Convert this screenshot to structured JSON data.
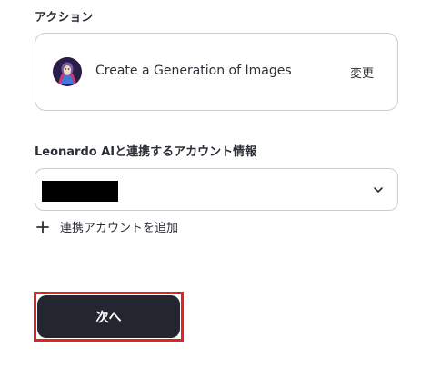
{
  "action": {
    "section_label": "アクション",
    "card": {
      "icon": "leonardo-ai-avatar-icon",
      "title": "Create a Generation of Images",
      "change_label": "変更"
    }
  },
  "account": {
    "section_label": "Leonardo AIと連携するアカウント情報",
    "select": {
      "selected_value": "",
      "selected_value_redacted": true,
      "chevron_icon": "chevron-down-icon"
    },
    "add_account": {
      "icon": "plus-icon",
      "label": "連携アカウントを追加"
    }
  },
  "footer": {
    "next_label": "次へ",
    "highlight_color": "#e02424",
    "button_color": "#23262e"
  }
}
